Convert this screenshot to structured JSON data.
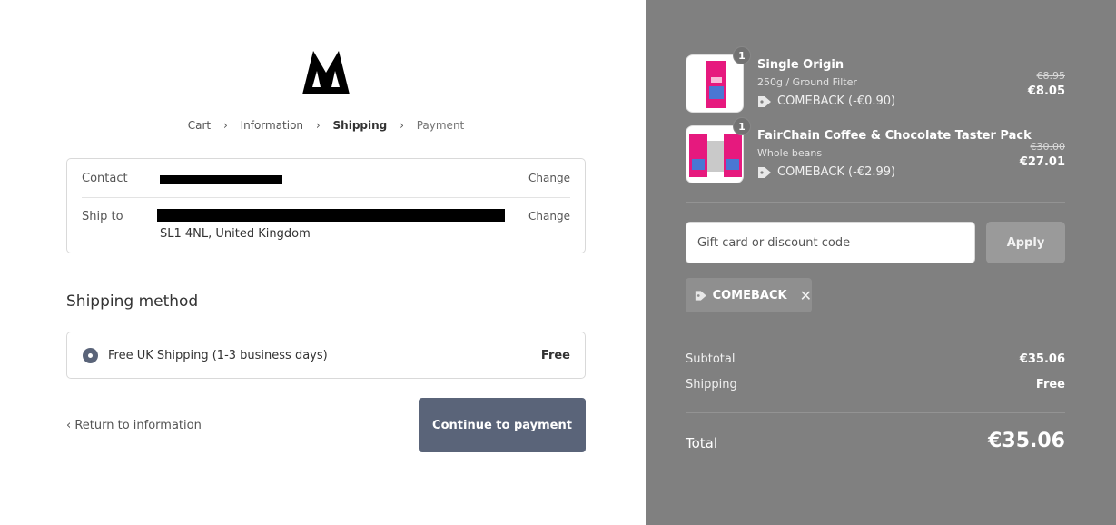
{
  "breadcrumb": {
    "cart": "Cart",
    "information": "Information",
    "shipping": "Shipping",
    "payment": "Payment"
  },
  "review": {
    "contact_label": "Contact",
    "ship_to_label": "Ship to",
    "ship_to_line2": "SL1 4NL, United Kingdom",
    "change_label": "Change"
  },
  "shipping_method": {
    "heading": "Shipping method",
    "option_name": "Free UK Shipping (1-3 business days)",
    "option_price": "Free"
  },
  "actions": {
    "return_label": "Return to information",
    "continue_label": "Continue to payment"
  },
  "cart": {
    "items": [
      {
        "quantity": "1",
        "title": "Single Origin",
        "variant": "250g / Ground Filter",
        "discount": "COMEBACK (-€0.90)",
        "original_price": "€8.95",
        "price": "€8.05"
      },
      {
        "quantity": "1",
        "title": "FairChain Coffee & Chocolate Taster Pack",
        "variant": "Whole beans",
        "discount": "COMEBACK (-€2.99)",
        "original_price": "€30.00",
        "price": "€27.01"
      }
    ],
    "discount_placeholder": "Gift card or discount code",
    "apply_label": "Apply",
    "applied_code": "COMEBACK",
    "subtotal_label": "Subtotal",
    "subtotal_value": "€35.06",
    "shipping_label": "Shipping",
    "shipping_value": "Free",
    "total_label": "Total",
    "total_value": "€35.06"
  },
  "colors": {
    "accent": "#5a6479",
    "sidebar_bg": "#808080"
  }
}
